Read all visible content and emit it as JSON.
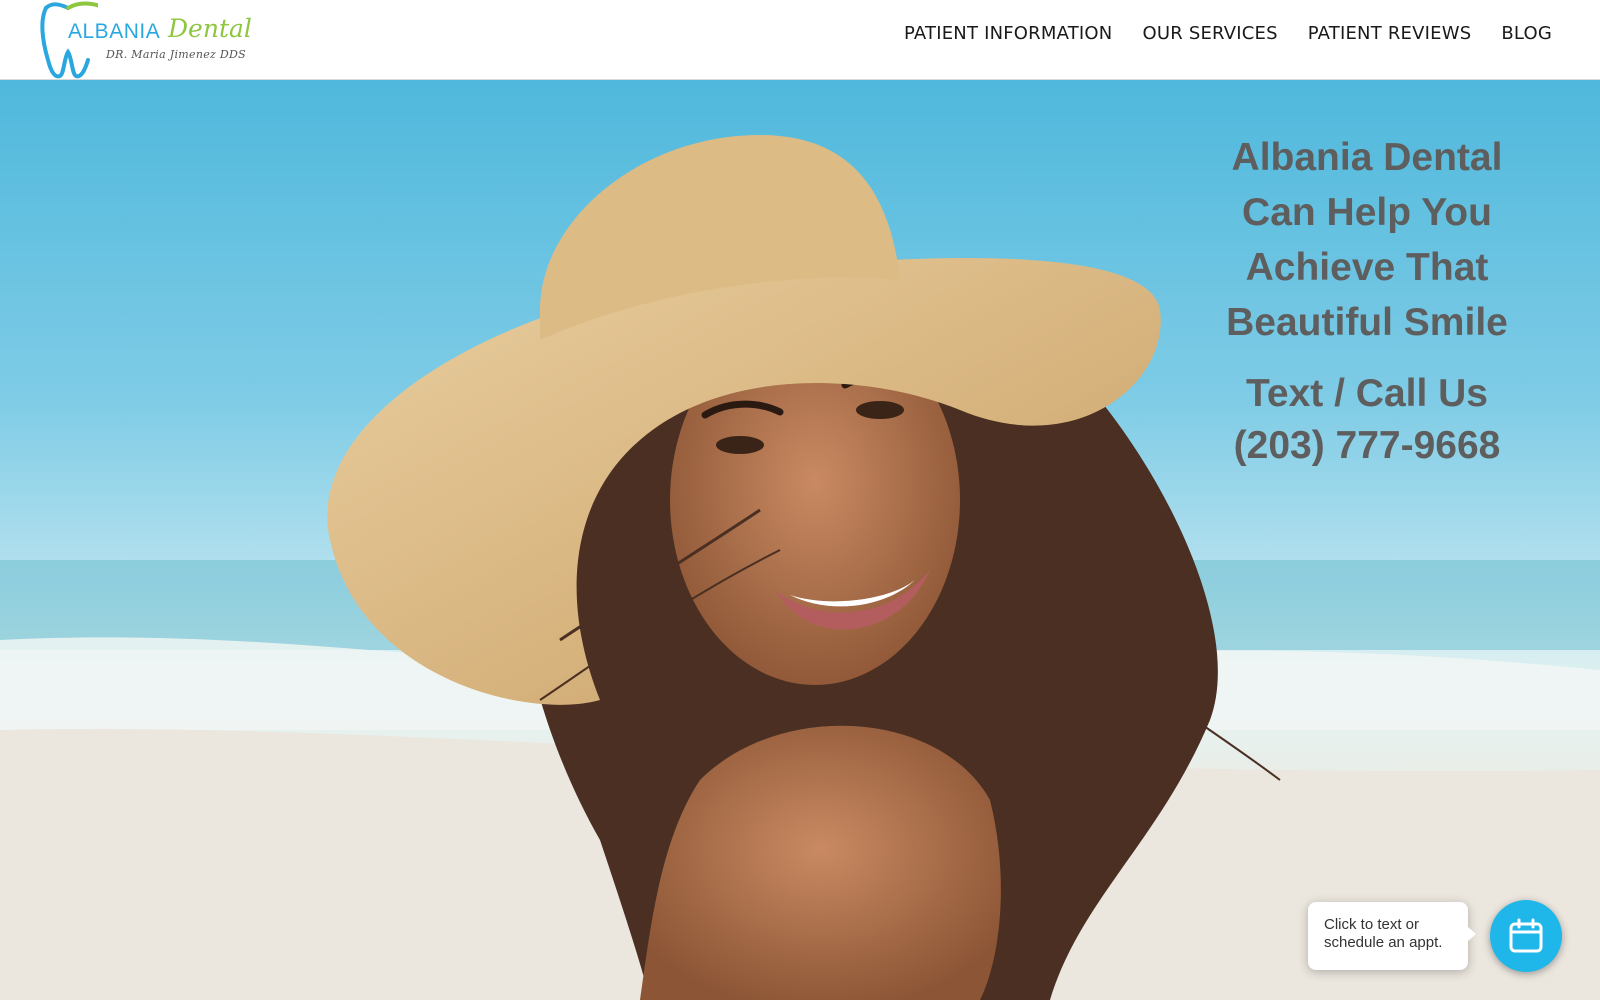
{
  "header": {
    "logo": {
      "name": "ALBANIA",
      "script": "Dental",
      "subtitle": "DR. Maria Jimenez DDS"
    },
    "nav": [
      {
        "label": "PATIENT INFORMATION"
      },
      {
        "label": "OUR SERVICES"
      },
      {
        "label": "PATIENT REVIEWS"
      },
      {
        "label": "BLOG"
      }
    ]
  },
  "hero": {
    "headline_lines": [
      "Albania Dental",
      "Can Help You",
      "Achieve That",
      "Beautiful Smile"
    ],
    "cta_lines": [
      "Text / Call Us",
      "(203) 777-9668"
    ]
  },
  "chat_widget": {
    "lines": [
      "Click to text or",
      "schedule an appt."
    ],
    "icon": "calendar-icon"
  },
  "colors": {
    "brand_blue": "#29a7de",
    "brand_green": "#8dc63f",
    "headline_gray": "#5e5e5e",
    "widget_blue": "#1fb6ea"
  }
}
